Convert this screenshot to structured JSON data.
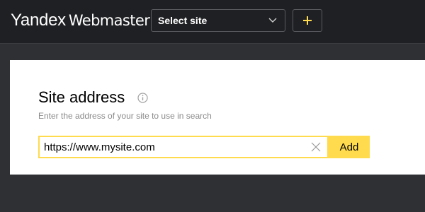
{
  "header": {
    "logo_brand": "Yandex",
    "logo_product": "Webmaster",
    "site_select_label": "Select site",
    "add_site_icon": "plus-icon",
    "accent_color": "#ffdb4d"
  },
  "add_site_form": {
    "title": "Site address",
    "info_icon": "info-icon",
    "subtitle": "Enter the address of your site to use in search",
    "url_value": "https://www.mysite.com",
    "clear_icon": "clear-icon",
    "add_button_label": "Add"
  }
}
